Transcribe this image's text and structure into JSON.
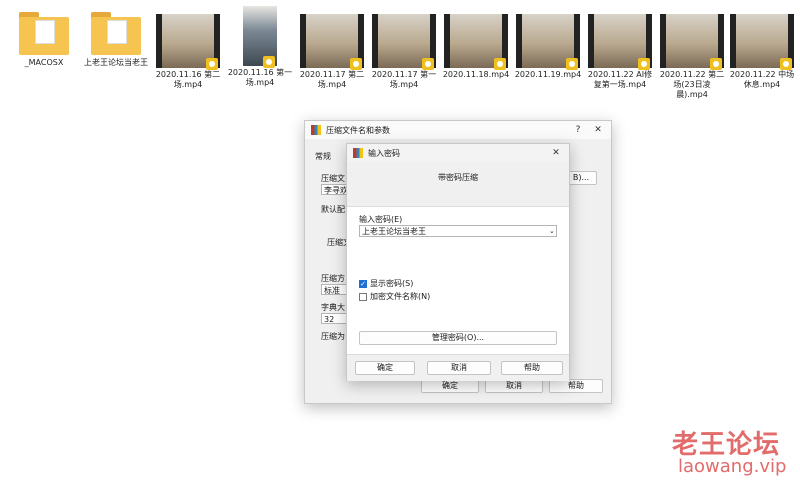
{
  "files": [
    {
      "name": "_MACOSX",
      "kind": "folder",
      "icon": "folder-icon"
    },
    {
      "name": "上老王论坛当老王",
      "kind": "folder",
      "icon": "folder-icon"
    },
    {
      "name": "2020.11.16 第二场.mp4",
      "kind": "video",
      "icon": "video-thumbnail-icon"
    },
    {
      "name": "2020.11.16 第一场.mp4",
      "kind": "video-tall",
      "icon": "video-thumbnail-icon"
    },
    {
      "name": "2020.11.17 第二场.mp4",
      "kind": "video",
      "icon": "video-thumbnail-icon"
    },
    {
      "name": "2020.11.17 第一场.mp4",
      "kind": "video",
      "icon": "video-thumbnail-icon"
    },
    {
      "name": "2020.11.18.mp4",
      "kind": "video",
      "icon": "video-thumbnail-icon"
    },
    {
      "name": "2020.11.19.mp4",
      "kind": "video",
      "icon": "video-thumbnail-icon"
    },
    {
      "name": "2020.11.22 AI修复第一场.mp4",
      "kind": "video",
      "icon": "video-thumbnail-icon"
    },
    {
      "name": "2020.11.22 第二场(23日凌晨).mp4",
      "kind": "video",
      "icon": "video-thumbnail-icon"
    },
    {
      "name": "2020.11.22 中场休息.mp4",
      "kind": "video",
      "icon": "video-thumbnail-icon"
    }
  ],
  "archive_dialog": {
    "title": "压缩文件名和参数",
    "help_glyph": "?",
    "close_glyph": "✕",
    "tab_general": "常规",
    "archive_name_label": "压缩文",
    "archive_name_value": "李寻欢",
    "browse_label": "B)...",
    "default_profile_label": "默认配",
    "format_label": "压缩文",
    "method_label": "压缩方",
    "method_value": "标准",
    "dict_label": "字典大",
    "dict_value": "32",
    "split_label": "压缩为",
    "ok": "确定",
    "cancel": "取消",
    "help": "帮助"
  },
  "password_dialog": {
    "title": "输入密码",
    "close_glyph": "✕",
    "heading": "带密码压缩",
    "password_label": "输入密码(E)",
    "password_value": "上老王论坛当老王",
    "show_password_label": "显示密码(S)",
    "show_password_checked": true,
    "encrypt_names_label": "加密文件名称(N)",
    "encrypt_names_checked": false,
    "manage_button": "管理密码(O)...",
    "ok": "确定",
    "cancel": "取消",
    "help": "帮助"
  },
  "watermark": {
    "line1": "老王论坛",
    "line2": "laowang.vip"
  }
}
